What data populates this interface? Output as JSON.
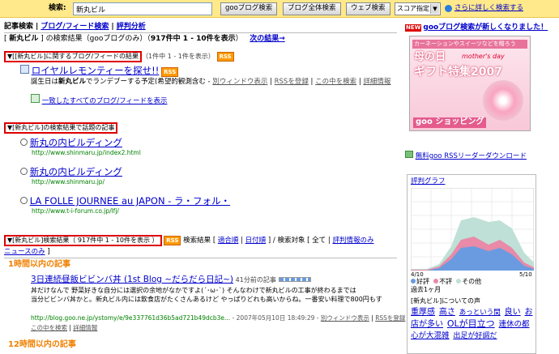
{
  "search": {
    "label": "検索:",
    "value": "新丸ビル",
    "buttons": [
      "gooブログ検索",
      "ブログ全体検索",
      "ウェブ検索"
    ],
    "scope": "スコア指定",
    "advanced_link": "さらに詳しく検索する"
  },
  "tabs": [
    "記事検索",
    "ブログ/フィード検索",
    "評判分析"
  ],
  "summary": {
    "prefix": "[",
    "query": "新丸ビル",
    "text": "] の検索結果（gooブログのみ）（",
    "count": "917件中 1 - 10件を表示",
    "close": "）",
    "next_link": "次の結果→"
  },
  "section1": {
    "head": "[新丸ビル]に関するブログ/フィードの結果",
    "note": "（1件中 1 - 1件を表示）",
    "rss": "RSS",
    "item": {
      "title": "ロイヤルレモンティーを探せ!!",
      "rss": "RSS",
      "desc_a": "誕生日は",
      "desc_bold": "新丸ビル",
      "desc_b": "でランデブーする予定(希望的観測含む -",
      "actions": [
        "別ウィンドウ表示",
        "RSSを登録",
        "この中を検索",
        "詳細情報"
      ]
    },
    "all_link": "一致したすべてのブログ/フィードを表示"
  },
  "section2": {
    "head": "▼[新丸ビル]の検索結果で話題の記事",
    "items": [
      {
        "title": "新丸の内ビルディング",
        "url": "http://www.shinmaru.jp/index2.html"
      },
      {
        "title": "新丸の内ビルディング",
        "url": "http://www.shinmaru.jp/"
      },
      {
        "title": "LA FOLLE JOURNEE au JAPON - ラ・フォル・",
        "url": "http://www.t-i-forum.co.jp/lfj/"
      }
    ]
  },
  "section3": {
    "head": "▼[新丸ビル]検索結果（ 917件中 1 - 10件を表示 ）",
    "rss": "RSS",
    "filter_label": "検索結果 [",
    "filters": [
      "適合順",
      "日付順"
    ],
    "target_label": "] / 検索対象 [ 全て |",
    "targets": [
      "評判情報のみ",
      "ニュースのみ"
    ],
    "target_close": "]",
    "cat1": "1時間以内の記事",
    "item": {
      "title": "3日連続昼飯ビビンバ丼 (1st Blog ~だらだら日記~)",
      "age": "41分前の記事",
      "desc_line1": "丼だけなんで 野菜好きな自分には選択の余地がなかですよ(´･ω･`) そんなわけで新丸ビルの工事が終わるまでは",
      "desc_line2": "当分ビビンバ丼かと。新丸ビル内には飲食店がたくさんあるけど やっぱりどれも高いからね。一番安い料理で800円もす",
      "url": "http://blog.goo.ne.jp/ystomy/e/9e337761d36b5ad721b49dcb3e...",
      "date": "- 2007年05月10日 18:49:29 -",
      "actions": [
        "別ウィンドウ表示",
        "RSSを登録",
        "この中を検索",
        "詳細情報"
      ]
    },
    "cat2": "12時間以内の記事"
  },
  "right": {
    "news_badge": "NEW",
    "news": "gooブログ検索が新しくなりました！",
    "ad": {
      "sub": "カーネーションやスイーツなどを贈ろう",
      "t1": "母の日",
      "t2": "mother's day",
      "t3": "ギフト特集2007",
      "logo": "goo ショッピング"
    },
    "rss_reader": "無料goo RSSリーダーダウンロード",
    "graph": {
      "title": "評判グラフ",
      "start": "4/10",
      "end": "5/10",
      "legend": [
        "好評",
        "不評",
        "その他"
      ],
      "period": "過去1ヶ月",
      "kw_label": "[新丸ビル]についての声",
      "keywords": [
        "重厚感",
        "高さ",
        "あっという間",
        "良い",
        "お店が多い",
        "OLが目立つ",
        "連休の都心が大混雑",
        "出足が好調だ"
      ],
      "colors": {
        "good": "#6a9be0",
        "bad": "#e88aa8",
        "other": "#bfe0d6"
      }
    }
  }
}
